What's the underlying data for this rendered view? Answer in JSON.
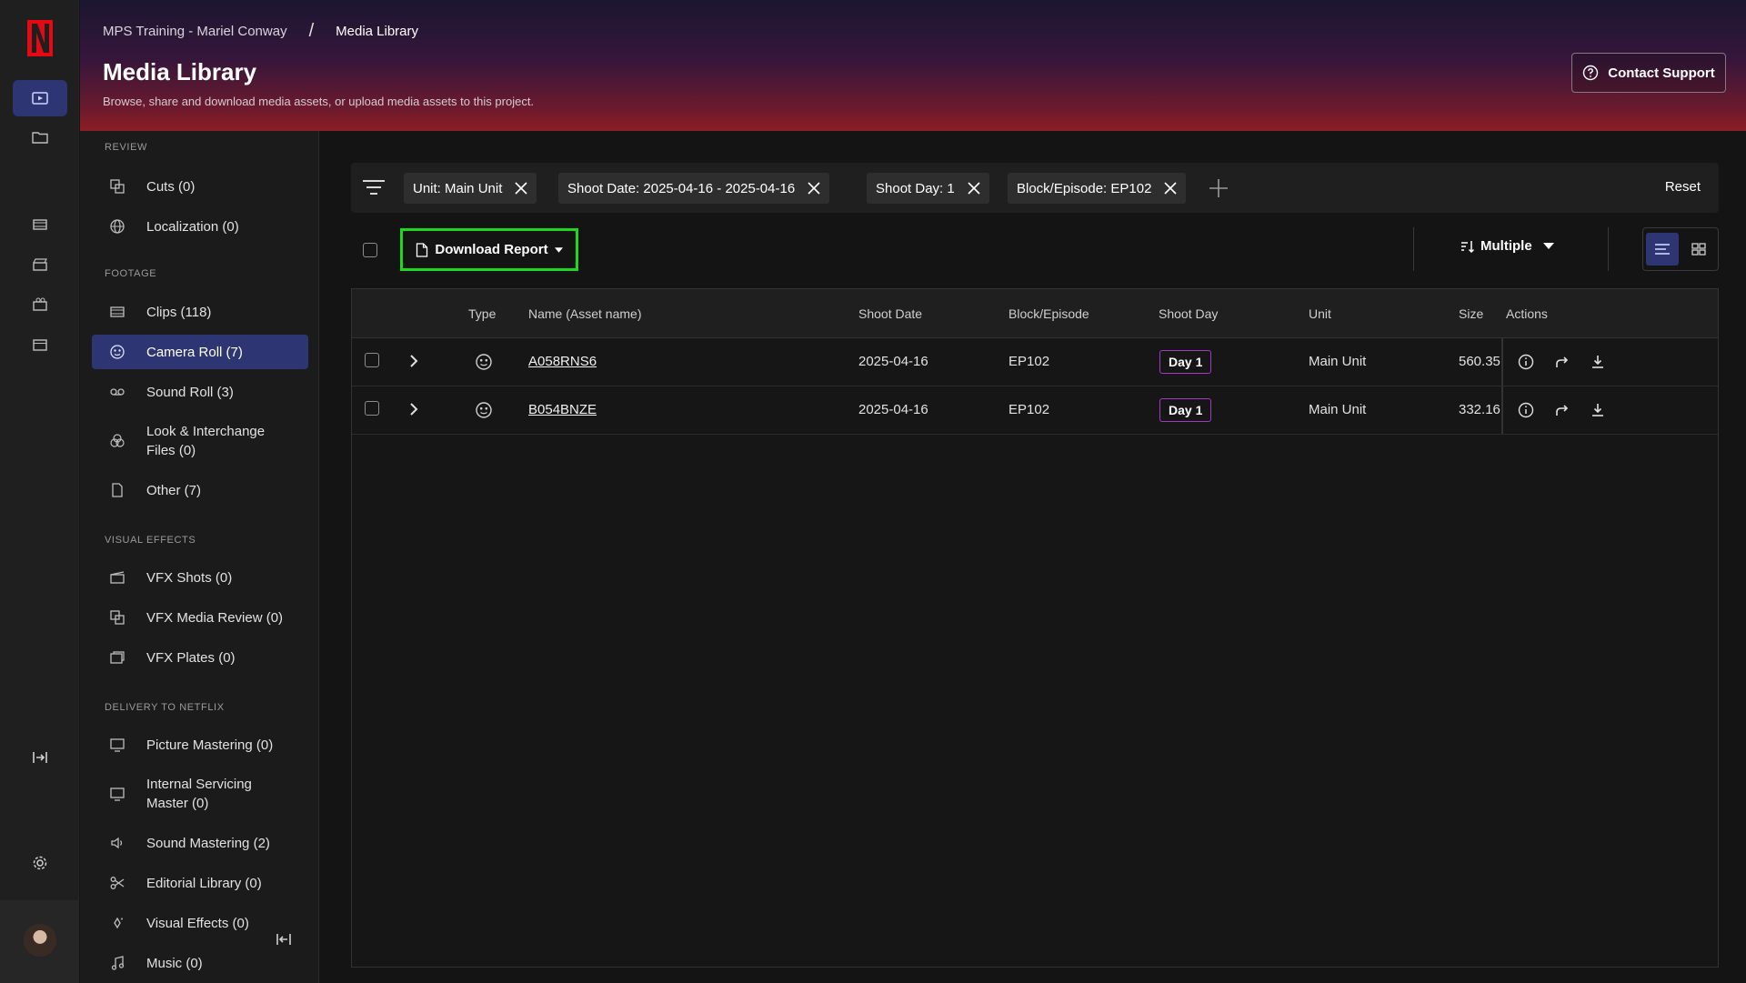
{
  "app": {
    "brand": "N",
    "brand_color": "#e50914"
  },
  "header": {
    "breadcrumbs": [
      "MPS Training - Mariel Conway",
      "Media Library"
    ],
    "separator": "/",
    "title": "Media Library",
    "subtitle": "Browse, share and download media assets, or upload media assets to this project.",
    "support_label": "Contact Support"
  },
  "sidebar": {
    "sections": {
      "review": "REVIEW",
      "footage": "FOOTAGE",
      "visual_effects": "VISUAL EFFECTS",
      "delivery": "DELIVERY TO NETFLIX"
    },
    "items": {
      "cuts": "Cuts (0)",
      "localization": "Localization (0)",
      "clips": "Clips (118)",
      "camera_roll": "Camera Roll (7)",
      "sound_roll": "Sound Roll (3)",
      "look_files": "Look & Interchange Files (0)",
      "other": "Other (7)",
      "vfx_shots": "VFX Shots (0)",
      "vfx_media_review": "VFX Media Review (0)",
      "vfx_plates": "VFX Plates (0)",
      "picture_mastering": "Picture Mastering (0)",
      "internal_servicing": "Internal Servicing Master (0)",
      "sound_mastering": "Sound Mastering (2)",
      "editorial_library": "Editorial Library (0)",
      "visual_effects": "Visual Effects (0)",
      "music": "Music (0)"
    },
    "active_item": "camera_roll"
  },
  "filters": {
    "chips": [
      "Unit: Main Unit",
      "Shoot Date: 2025-04-16 - 2025-04-16",
      "Shoot Day: 1",
      "Block/Episode: EP102"
    ],
    "reset_label": "Reset"
  },
  "toolbar": {
    "download_report_label": "Download Report",
    "sort_label": "Multiple",
    "view_mode": "list"
  },
  "table": {
    "columns": {
      "type": "Type",
      "name": "Name (Asset name)",
      "shoot_date": "Shoot Date",
      "block": "Block/Episode",
      "shoot_day": "Shoot Day",
      "unit": "Unit",
      "size": "Size",
      "actions": "Actions"
    },
    "rows": [
      {
        "name": "A058RNS6",
        "shoot_date": "2025-04-16",
        "block": "EP102",
        "shoot_day": "Day 1",
        "unit": "Main Unit",
        "size": "560.35"
      },
      {
        "name": "B054BNZE",
        "shoot_date": "2025-04-16",
        "block": "EP102",
        "shoot_day": "Day 1",
        "unit": "Main Unit",
        "size": "332.16"
      }
    ]
  },
  "colors": {
    "accent": "#2e3573",
    "highlight_box": "#1ed91b",
    "day_badge_border": "#a237c9"
  }
}
